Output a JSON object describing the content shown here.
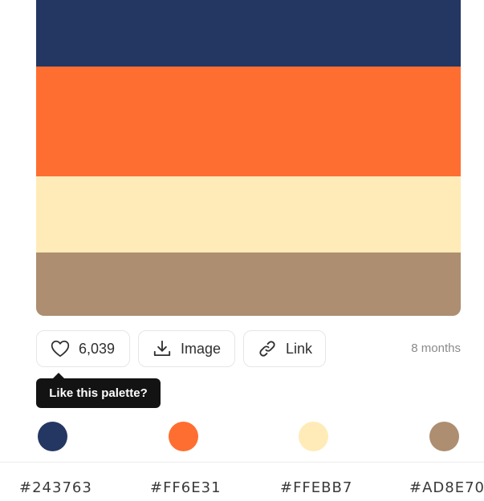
{
  "palette": {
    "colors": [
      {
        "hex": "#243763",
        "label": "#243763"
      },
      {
        "hex": "#FF6E31",
        "label": "#FF6E31"
      },
      {
        "hex": "#FFEBB7",
        "label": "#FFEBB7"
      },
      {
        "hex": "#AD8E70",
        "label": "#AD8E70"
      }
    ]
  },
  "actions": {
    "like_count": "6,039",
    "like_icon": "heart-icon",
    "image_label": "Image",
    "image_icon": "download-icon",
    "link_label": "Link",
    "link_icon": "link-icon",
    "age": "8 months"
  },
  "tooltip": {
    "text": "Like this palette?"
  }
}
